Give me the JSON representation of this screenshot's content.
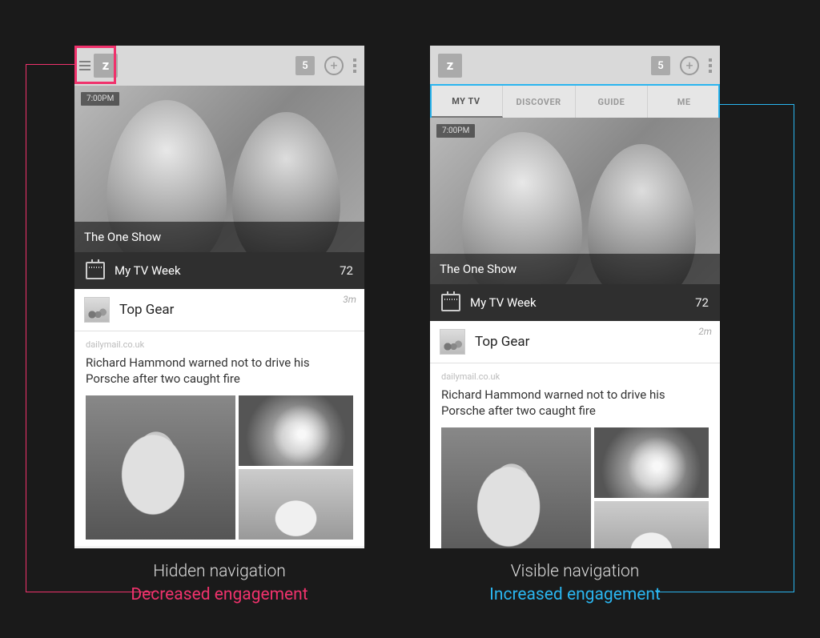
{
  "appbar": {
    "logo_letter": "z",
    "badge": "5"
  },
  "tabs": [
    "MY TV",
    "DISCOVER",
    "GUIDE",
    "ME"
  ],
  "feature": {
    "time": "7:00PM",
    "title": "The One Show"
  },
  "mytvweek": {
    "label": "My TV Week",
    "count": "72"
  },
  "card": {
    "title": "Top Gear",
    "time_left": "3m",
    "time_right": "2m"
  },
  "article": {
    "source": "dailymail.co.uk",
    "headline": "Richard Hammond warned not to drive his Porsche after two caught fire"
  },
  "captions": {
    "hidden_title": "Hidden navigation",
    "hidden_sub": "Decreased engagement",
    "visible_title": "Visible navigation",
    "visible_sub": "Increased engagement"
  }
}
